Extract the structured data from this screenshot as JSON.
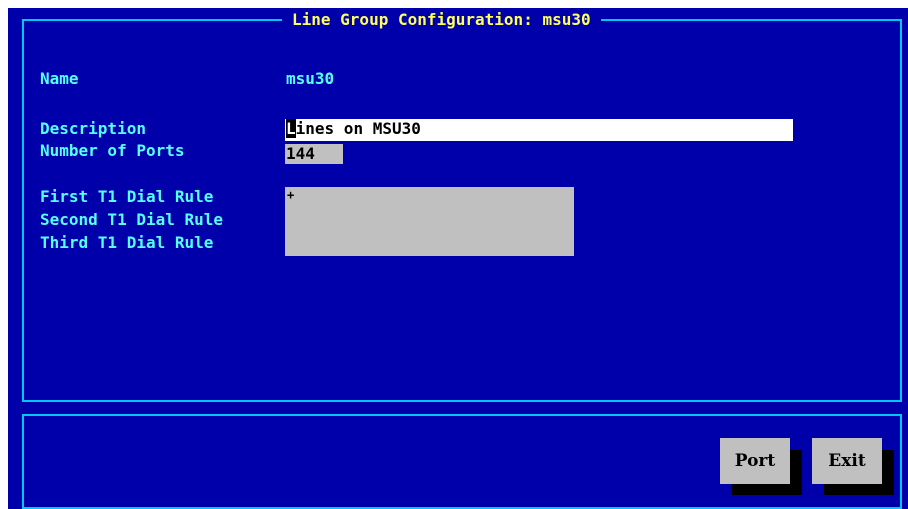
{
  "window": {
    "title": "Line Group Configuration: msu30"
  },
  "form": {
    "name_label": "Name",
    "name_value": "msu30",
    "description_label": "Description",
    "description_cursor_char": "L",
    "description_rest": "ines on MSU30",
    "ports_label": "Number of Ports",
    "ports_value": "144",
    "first_rule_label": "First T1 Dial Rule",
    "second_rule_label": "Second T1 Dial Rule",
    "third_rule_label": "Third T1 Dial Rule",
    "dial_rules_value": "+"
  },
  "buttons": {
    "port_label": "Port",
    "exit_label": "Exit"
  },
  "colors": {
    "background": "#0000aa",
    "label": "#55ffff",
    "title": "#ffff55",
    "border": "#00c8ff",
    "field_active": "#ffffff",
    "field_inactive": "#c0c0c0"
  }
}
